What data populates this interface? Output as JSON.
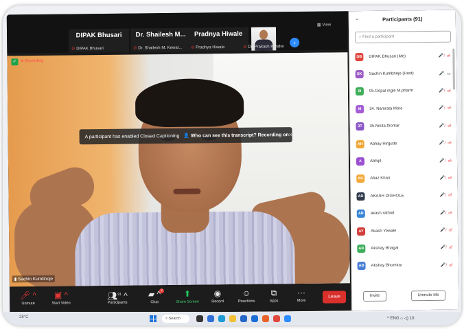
{
  "filmstrip": {
    "thumbs": [
      {
        "name": "DIPAK Bhusari",
        "sub": "DIPAK Bhusari"
      },
      {
        "name": "Dr. Shailesh M...",
        "sub": "Dr. Shailesh M. Kewat..."
      },
      {
        "name": "Pradnya Hiwale",
        "sub": "Pradnya Hiwale"
      }
    ],
    "photo_sub": "Dr. Prakash Kandre",
    "view_label": "View"
  },
  "main": {
    "recording_label": "Recording",
    "speaker_name": "Sachin Kumbhoje",
    "cc_toast": {
      "message": "A participant has enabled Closed Captioning",
      "question": "Who can see this transcript? Recording on",
      "close": "×"
    }
  },
  "toolbar": {
    "unmute": "Unmute",
    "start_video": "Start Video",
    "participants": "Participants",
    "participants_count": "91",
    "chat": "Chat",
    "chat_badge": "2",
    "share_screen": "Share Screen",
    "record": "Record",
    "reactions": "Reactions",
    "apps": "Apps",
    "more": "More",
    "leave": "Leave"
  },
  "panel": {
    "title": "Participants (91)",
    "search_placeholder": "Find a participant",
    "participants": [
      {
        "initials": "DB",
        "name": "DIPAK Bhusari (Me)",
        "color": "#e0463e"
      },
      {
        "initials": "SK",
        "name": "Sachin Kumbhoje (Host)",
        "color": "#9b5cc7"
      },
      {
        "initials": "0I",
        "name": "05.Gopal ingle M.pharm",
        "color": "#3fae5a"
      },
      {
        "initials": "M",
        "name": "34. Namrata More",
        "color": "#a45cd6"
      },
      {
        "initials": "3T",
        "name": "35.Nikita thorkar",
        "color": "#8c58c8"
      },
      {
        "initials": "AH",
        "name": "Abhay Hirgude",
        "color": "#f0a838"
      },
      {
        "initials": "A",
        "name": "Abhijit",
        "color": "#9a4fd0"
      },
      {
        "initials": "AK",
        "name": "Afiaz Khan",
        "color": "#f3a93a"
      },
      {
        "initials": "AD",
        "name": "AKASH DIGHOLE",
        "color": "#2f3a4a"
      },
      {
        "initials": "AR",
        "name": "akash rathod",
        "color": "#3a86d6"
      },
      {
        "initials": "AY",
        "name": "Akash Yewale",
        "color": "#d23e3a"
      },
      {
        "initials": "AB",
        "name": "Akshay Bhagat",
        "color": "#3cae5c"
      },
      {
        "initials": "AB",
        "name": "Akshay Bhumkar",
        "color": "#4a7fd6"
      }
    ],
    "muted_icons": "🎤̸ ▭̸",
    "host_icons": "🎤 ▭",
    "invite": "Invite",
    "unmute_me": "Unmute Me"
  },
  "taskbar": {
    "weather": "28°C",
    "search": "Search",
    "tray": "^ ENG ⌂ ◁) 10:"
  }
}
